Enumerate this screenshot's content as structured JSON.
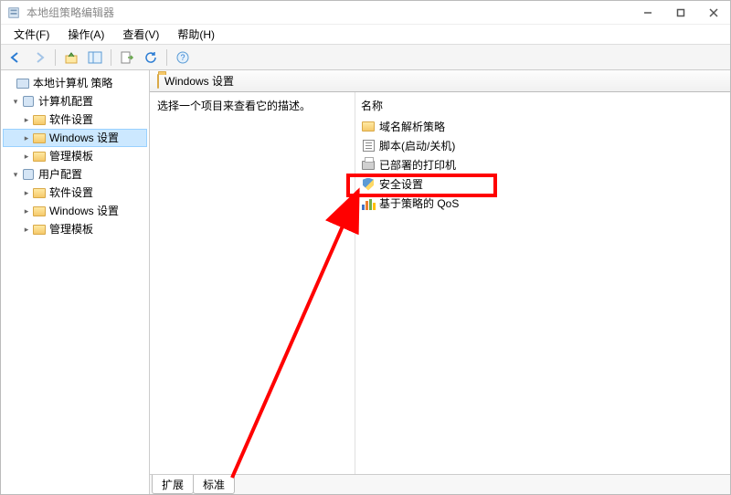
{
  "window": {
    "title": "本地组策略编辑器"
  },
  "menu": {
    "file": "文件(F)",
    "action": "操作(A)",
    "view": "查看(V)",
    "help": "帮助(H)"
  },
  "tree": {
    "root": "本地计算机 策略",
    "computer_config": "计算机配置",
    "software_settings": "软件设置",
    "windows_settings": "Windows 设置",
    "admin_templates": "管理模板",
    "user_config": "用户配置"
  },
  "content": {
    "header": "Windows 设置",
    "desc_prompt": "选择一个项目来查看它的描述。",
    "col_name": "名称",
    "items": [
      {
        "key": "dns_policy",
        "icon": "folder",
        "label": "域名解析策略"
      },
      {
        "key": "scripts",
        "icon": "script",
        "label": "脚本(启动/关机)"
      },
      {
        "key": "printers",
        "icon": "printer",
        "label": "已部署的打印机"
      },
      {
        "key": "security",
        "icon": "shield",
        "label": "安全设置"
      },
      {
        "key": "qos",
        "icon": "chart",
        "label": "基于策略的 QoS"
      }
    ]
  },
  "tabs": {
    "extended": "扩展",
    "standard": "标准"
  },
  "highlight": {
    "target_item_key": "security"
  }
}
